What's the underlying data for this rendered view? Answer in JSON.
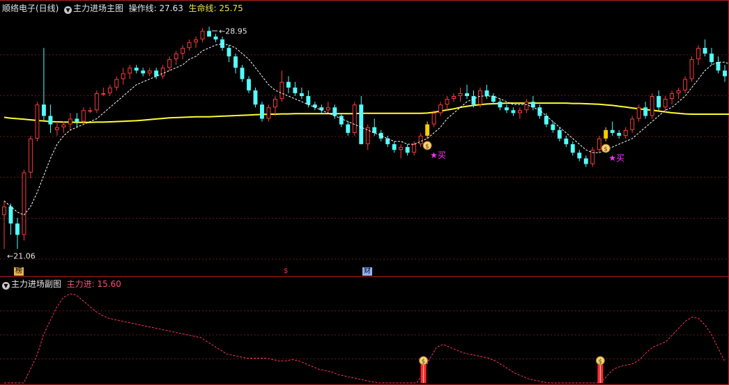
{
  "header": {
    "stock_name": "顺络电子(日线)",
    "main_indicator_name": "主力进场主图",
    "op_line_label": "操作线: 27.63",
    "life_line_label": "生命线: 25.75"
  },
  "sub_header": {
    "indicator_name": "主力进场副图",
    "value_label": "主力进: 15.60"
  },
  "markers": {
    "high_label": "28.95",
    "low_label": "21.06",
    "buy_label": "买",
    "event_tag_1": "榜",
    "event_tag_2": "$",
    "event_tag_3": "财"
  },
  "colors": {
    "up": "#ff3b3b",
    "down": "#54ffff",
    "life_line": "#ffff33",
    "op_line": "#ffffff",
    "sub_line": "#ff3366",
    "grid": "#6e1515",
    "buy_star": "#ff33ff"
  },
  "chart_data": [
    {
      "type": "candlestick",
      "series": [
        {
          "name": "主力进场主图",
          "ohlc": [
            [
              22.3,
              22.8,
              21.1,
              22.6
            ],
            [
              22.6,
              22.7,
              21.6,
              22.0
            ],
            [
              22.0,
              22.2,
              21.1,
              21.6
            ],
            [
              21.6,
              23.9,
              21.4,
              23.8
            ],
            [
              23.8,
              25.1,
              23.6,
              25.0
            ],
            [
              25.0,
              26.3,
              24.9,
              26.2
            ],
            [
              26.2,
              28.2,
              25.6,
              25.8
            ],
            [
              25.8,
              26.2,
              25.2,
              25.5
            ],
            [
              25.3,
              25.6,
              25.1,
              25.4
            ],
            [
              25.4,
              25.6,
              25.2,
              25.5
            ],
            [
              25.5,
              25.9,
              25.3,
              25.7
            ],
            [
              25.7,
              25.9,
              25.4,
              25.6
            ],
            [
              25.6,
              26.1,
              25.5,
              26.0
            ],
            [
              26.0,
              26.1,
              25.9,
              26.0
            ],
            [
              26.0,
              26.7,
              25.9,
              26.6
            ],
            [
              26.6,
              26.8,
              26.5,
              26.6
            ],
            [
              26.6,
              26.9,
              26.5,
              26.8
            ],
            [
              26.8,
              27.2,
              26.7,
              27.1
            ],
            [
              27.1,
              27.5,
              26.9,
              27.3
            ],
            [
              27.3,
              27.6,
              27.1,
              27.5
            ],
            [
              27.5,
              27.6,
              27.3,
              27.4
            ],
            [
              27.4,
              27.5,
              27.2,
              27.3
            ],
            [
              27.3,
              27.5,
              27.2,
              27.4
            ],
            [
              27.4,
              27.5,
              27.1,
              27.2
            ],
            [
              27.2,
              27.6,
              27.1,
              27.5
            ],
            [
              27.5,
              27.9,
              27.4,
              27.8
            ],
            [
              27.8,
              28.1,
              27.6,
              28.0
            ],
            [
              28.0,
              28.3,
              27.8,
              28.2
            ],
            [
              28.2,
              28.5,
              28.1,
              28.4
            ],
            [
              28.4,
              28.6,
              28.2,
              28.5
            ],
            [
              28.5,
              28.9,
              28.4,
              28.8
            ],
            [
              28.8,
              28.95,
              28.6,
              28.6
            ],
            [
              28.6,
              28.7,
              28.4,
              28.5
            ],
            [
              28.5,
              28.6,
              28.1,
              28.2
            ],
            [
              28.2,
              28.3,
              27.7,
              27.9
            ],
            [
              27.9,
              28.0,
              27.3,
              27.5
            ],
            [
              27.5,
              27.6,
              27.0,
              27.1
            ],
            [
              27.1,
              27.2,
              26.6,
              26.7
            ],
            [
              26.7,
              26.8,
              26.1,
              26.2
            ],
            [
              26.2,
              26.3,
              25.6,
              25.7
            ],
            [
              25.7,
              26.2,
              25.6,
              26.1
            ],
            [
              26.1,
              26.5,
              25.8,
              26.4
            ],
            [
              26.4,
              27.4,
              26.3,
              27.0
            ],
            [
              27.0,
              27.2,
              26.6,
              26.8
            ],
            [
              26.8,
              27.0,
              26.5,
              26.6
            ],
            [
              26.6,
              26.8,
              26.4,
              26.5
            ],
            [
              26.5,
              26.7,
              26.1,
              26.2
            ],
            [
              26.2,
              26.3,
              26.0,
              26.1
            ],
            [
              26.1,
              26.2,
              25.9,
              26.0
            ],
            [
              26.0,
              26.3,
              25.9,
              26.1
            ],
            [
              26.1,
              26.2,
              25.7,
              25.8
            ],
            [
              25.8,
              25.9,
              25.4,
              25.5
            ],
            [
              25.5,
              25.6,
              25.1,
              25.2
            ],
            [
              25.2,
              26.3,
              25.1,
              26.2
            ],
            [
              26.2,
              26.5,
              24.8,
              24.8
            ],
            [
              24.8,
              25.5,
              24.6,
              25.4
            ],
            [
              25.4,
              25.7,
              25.1,
              25.2
            ],
            [
              25.2,
              25.3,
              24.9,
              25.0
            ],
            [
              25.0,
              25.1,
              24.7,
              24.8
            ],
            [
              24.8,
              24.9,
              24.5,
              24.6
            ],
            [
              24.6,
              24.8,
              24.3,
              24.7
            ],
            [
              24.7,
              24.8,
              24.4,
              24.5
            ],
            [
              24.5,
              24.9,
              24.4,
              24.8
            ],
            [
              24.8,
              25.2,
              24.7,
              25.1
            ],
            [
              25.1,
              25.6,
              25.0,
              25.5
            ],
            [
              25.5,
              26.0,
              25.4,
              25.9
            ],
            [
              25.9,
              26.3,
              25.8,
              26.2
            ],
            [
              26.2,
              26.5,
              26.0,
              26.4
            ],
            [
              26.4,
              26.6,
              26.3,
              26.5
            ],
            [
              26.5,
              26.8,
              26.3,
              26.6
            ],
            [
              26.6,
              26.9,
              26.4,
              26.5
            ],
            [
              26.5,
              26.7,
              26.1,
              26.2
            ],
            [
              26.2,
              26.8,
              26.1,
              26.7
            ],
            [
              26.7,
              26.9,
              26.4,
              26.5
            ],
            [
              26.5,
              26.6,
              26.2,
              26.3
            ],
            [
              26.3,
              26.4,
              26.0,
              26.1
            ],
            [
              26.1,
              26.2,
              25.9,
              26.0
            ],
            [
              26.0,
              26.1,
              25.8,
              25.9
            ],
            [
              25.9,
              26.1,
              25.7,
              26.0
            ],
            [
              26.0,
              26.4,
              25.9,
              26.3
            ],
            [
              26.3,
              26.5,
              26.0,
              26.1
            ],
            [
              26.1,
              26.2,
              25.7,
              25.8
            ],
            [
              25.8,
              25.9,
              25.4,
              25.5
            ],
            [
              25.5,
              25.6,
              25.2,
              25.3
            ],
            [
              25.3,
              25.4,
              24.9,
              25.0
            ],
            [
              25.0,
              25.1,
              24.7,
              24.8
            ],
            [
              24.8,
              24.9,
              24.4,
              24.5
            ],
            [
              24.5,
              24.6,
              24.2,
              24.3
            ],
            [
              24.3,
              24.4,
              24.0,
              24.1
            ],
            [
              24.1,
              24.7,
              24.0,
              24.6
            ],
            [
              24.6,
              25.1,
              24.5,
              25.0
            ],
            [
              25.0,
              25.4,
              24.9,
              25.3
            ],
            [
              25.3,
              25.6,
              25.1,
              25.2
            ],
            [
              25.2,
              25.3,
              25.0,
              25.1
            ],
            [
              25.1,
              25.4,
              25.0,
              25.3
            ],
            [
              25.3,
              25.8,
              25.2,
              25.7
            ],
            [
              25.7,
              26.2,
              25.6,
              26.1
            ],
            [
              26.1,
              26.3,
              25.7,
              25.8
            ],
            [
              25.8,
              26.6,
              25.7,
              26.5
            ],
            [
              26.5,
              26.7,
              26.0,
              26.1
            ],
            [
              26.1,
              26.5,
              25.9,
              26.4
            ],
            [
              26.4,
              26.7,
              26.2,
              26.6
            ],
            [
              26.6,
              26.8,
              26.4,
              26.7
            ],
            [
              26.7,
              27.2,
              26.6,
              27.1
            ],
            [
              27.1,
              27.9,
              27.0,
              27.8
            ],
            [
              27.8,
              28.3,
              27.6,
              28.2
            ],
            [
              28.2,
              28.5,
              27.9,
              28.0
            ],
            [
              28.0,
              28.2,
              27.6,
              27.7
            ],
            [
              27.7,
              27.9,
              27.3,
              27.4
            ],
            [
              27.4,
              27.6,
              27.0,
              27.2
            ]
          ]
        },
        {
          "name": "生命线",
          "values": [
            25.75,
            25.72,
            25.7,
            25.68,
            25.66,
            25.64,
            25.62,
            25.6,
            25.59,
            25.58,
            25.58,
            25.57,
            25.57,
            25.57,
            25.58,
            25.58,
            25.59,
            25.6,
            25.61,
            25.62,
            25.63,
            25.65,
            25.67,
            25.69,
            25.71,
            25.73,
            25.74,
            25.75,
            25.76,
            25.77,
            25.77,
            25.77,
            25.78,
            25.79,
            25.8,
            25.81,
            25.82,
            25.83,
            25.84,
            25.85,
            25.86,
            25.86,
            25.87,
            25.87,
            25.88,
            25.88,
            25.88,
            25.88,
            25.88,
            25.88,
            25.88,
            25.88,
            25.88,
            25.88,
            25.89,
            25.89,
            25.89,
            25.89,
            25.89,
            25.89,
            25.89,
            25.89,
            25.89,
            25.89,
            25.9,
            25.93,
            25.97,
            26.01,
            26.05,
            26.1,
            26.14,
            26.17,
            26.2,
            26.22,
            26.23,
            26.24,
            26.25,
            26.25,
            26.25,
            26.25,
            26.25,
            26.25,
            26.25,
            26.25,
            26.25,
            26.25,
            26.24,
            26.24,
            26.23,
            26.22,
            26.21,
            26.19,
            26.17,
            26.14,
            26.11,
            26.08,
            26.05,
            26.02,
            26.0,
            25.97,
            25.94,
            25.91,
            25.89,
            25.87,
            25.86,
            25.86,
            25.86,
            25.86,
            25.86,
            25.86,
            25.86
          ]
        },
        {
          "name": "操作线",
          "values": [
            22.8,
            22.6,
            22.4,
            22.3,
            22.6,
            23.1,
            23.7,
            24.3,
            24.8,
            25.1,
            25.3,
            25.4,
            25.5,
            25.6,
            25.7,
            25.9,
            26.1,
            26.3,
            26.5,
            26.7,
            26.9,
            27.0,
            27.1,
            27.2,
            27.3,
            27.4,
            27.5,
            27.6,
            27.8,
            27.9,
            28.1,
            28.2,
            28.3,
            28.35,
            28.3,
            28.2,
            28.0,
            27.8,
            27.5,
            27.2,
            26.9,
            26.7,
            26.6,
            26.5,
            26.4,
            26.3,
            26.2,
            26.1,
            26.0,
            25.9,
            25.8,
            25.7,
            25.6,
            25.5,
            25.4,
            25.3,
            25.2,
            25.1,
            25.0,
            24.9,
            24.9,
            24.8,
            24.8,
            24.9,
            25.0,
            25.2,
            25.4,
            25.7,
            25.9,
            26.1,
            26.3,
            26.4,
            26.5,
            26.5,
            26.5,
            26.4,
            26.3,
            26.2,
            26.2,
            26.2,
            26.1,
            26.0,
            25.8,
            25.6,
            25.4,
            25.2,
            25.0,
            24.8,
            24.6,
            24.5,
            24.5,
            24.6,
            24.7,
            24.8,
            24.9,
            25.0,
            25.2,
            25.4,
            25.6,
            25.8,
            26.0,
            26.1,
            26.3,
            26.5,
            26.8,
            27.1,
            27.4,
            27.6,
            27.7,
            27.7,
            27.6
          ]
        }
      ],
      "ylim": [
        20.6,
        29.4
      ],
      "grid": true,
      "buy_signals": [
        64,
        91
      ],
      "highlight_candles": [
        64,
        91
      ]
    },
    {
      "type": "line",
      "series": [
        {
          "name": "主力进",
          "values": [
            0,
            0,
            0,
            0,
            10,
            20,
            35,
            45,
            55,
            62,
            65,
            64,
            60,
            56,
            52,
            49,
            47,
            46,
            45,
            44,
            43,
            42,
            41,
            40,
            39,
            38,
            37,
            36,
            35,
            34,
            33,
            30,
            27,
            24,
            21,
            20,
            19,
            18,
            18,
            18,
            18,
            17,
            16,
            16,
            17,
            16,
            14,
            12,
            10,
            9,
            8,
            6,
            5,
            4,
            3,
            2,
            1,
            0,
            0,
            0,
            0,
            0,
            0,
            0,
            8,
            18,
            26,
            28,
            26,
            24,
            22,
            21,
            20,
            19,
            18,
            16,
            13,
            10,
            7,
            5,
            3,
            2,
            1,
            0,
            0,
            0,
            0,
            0,
            0,
            0,
            0,
            0,
            5,
            10,
            12,
            13,
            14,
            17,
            22,
            26,
            28,
            30,
            35,
            40,
            45,
            48,
            47,
            42,
            35,
            25,
            15.6
          ]
        }
      ],
      "ylim": [
        0,
        70
      ],
      "grid": true,
      "signal_bars": [
        64,
        91
      ]
    }
  ]
}
